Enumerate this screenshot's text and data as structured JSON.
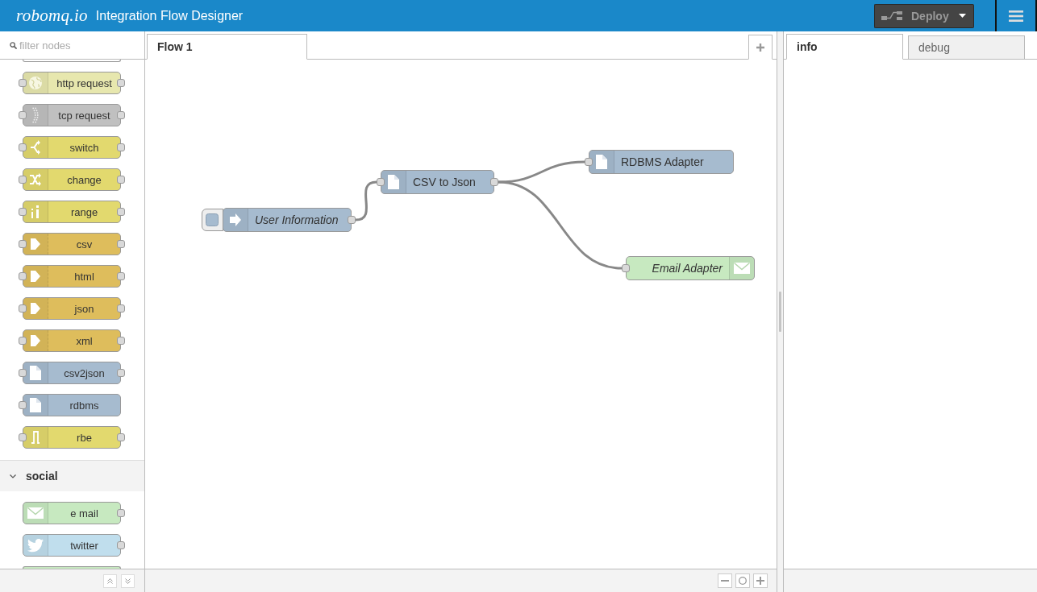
{
  "header": {
    "logo": "robomq.io",
    "title": "Integration Flow Designer",
    "deploy": {
      "label": "Deploy",
      "disabled": true
    }
  },
  "palette": {
    "filter": {
      "placeholder": "filter nodes"
    },
    "categories": [
      {
        "nodes": [
          {
            "kind": "clipped",
            "color": "#ffffff"
          },
          {
            "label": "http request",
            "kind": "globe",
            "color": "#e7e7ae",
            "input": true,
            "output": true
          },
          {
            "label": "tcp request",
            "kind": "dots",
            "color": "#c0c0c0",
            "input": true,
            "output": true
          },
          {
            "label": "switch",
            "kind": "switch",
            "color": "#e2d96e",
            "input": true,
            "output": true
          },
          {
            "label": "change",
            "kind": "shuffle",
            "color": "#e2d96e",
            "input": true,
            "output": true
          },
          {
            "label": "range",
            "kind": "range",
            "color": "#e2d96e",
            "input": true,
            "output": true
          },
          {
            "label": "csv",
            "kind": "arrow",
            "color": "#debd5c",
            "input": true,
            "output": true
          },
          {
            "label": "html",
            "kind": "arrow",
            "color": "#debd5c",
            "input": true,
            "output": true
          },
          {
            "label": "json",
            "kind": "arrow",
            "color": "#debd5c",
            "input": true,
            "output": true
          },
          {
            "label": "xml",
            "kind": "arrow",
            "color": "#debd5c",
            "input": true,
            "output": true
          },
          {
            "label": "csv2json",
            "kind": "file",
            "color": "#a6bbcf",
            "input": true,
            "output": true
          },
          {
            "label": "rdbms",
            "kind": "file",
            "color": "#a6bbcf",
            "input": true,
            "output": false
          },
          {
            "label": "rbe",
            "kind": "bracket",
            "color": "#e2d96e",
            "input": true,
            "output": true
          }
        ]
      },
      {
        "name": "social",
        "expanded": true,
        "nodes": [
          {
            "label": "e mail",
            "kind": "envelope",
            "color": "#c7e9c0",
            "input": false,
            "output": true
          },
          {
            "label": "twitter",
            "kind": "bird",
            "color": "#c0deed",
            "input": false,
            "output": true
          },
          {
            "kind": "clipped",
            "color": "#c7e9c0"
          }
        ]
      }
    ]
  },
  "workspace": {
    "tabs": [
      {
        "label": "Flow 1",
        "selected": true
      }
    ]
  },
  "flow": {
    "nodes": [
      {
        "label": "User Information",
        "kind": "inject",
        "color": "#a6bbcf",
        "input": false,
        "output": true
      },
      {
        "label": "CSV to Json",
        "kind": "file",
        "color": "#a6bbcf",
        "input": true,
        "output": true
      },
      {
        "label": "RDBMS Adapter",
        "kind": "file",
        "color": "#a6bbcf",
        "input": true,
        "output": false
      },
      {
        "label": "Email Adapter",
        "kind": "mail",
        "color": "#c7e9c0",
        "input": true,
        "output": false
      }
    ]
  },
  "sidebar": {
    "tabs": [
      {
        "label": "info",
        "selected": true
      },
      {
        "label": "debug",
        "selected": false
      }
    ]
  }
}
